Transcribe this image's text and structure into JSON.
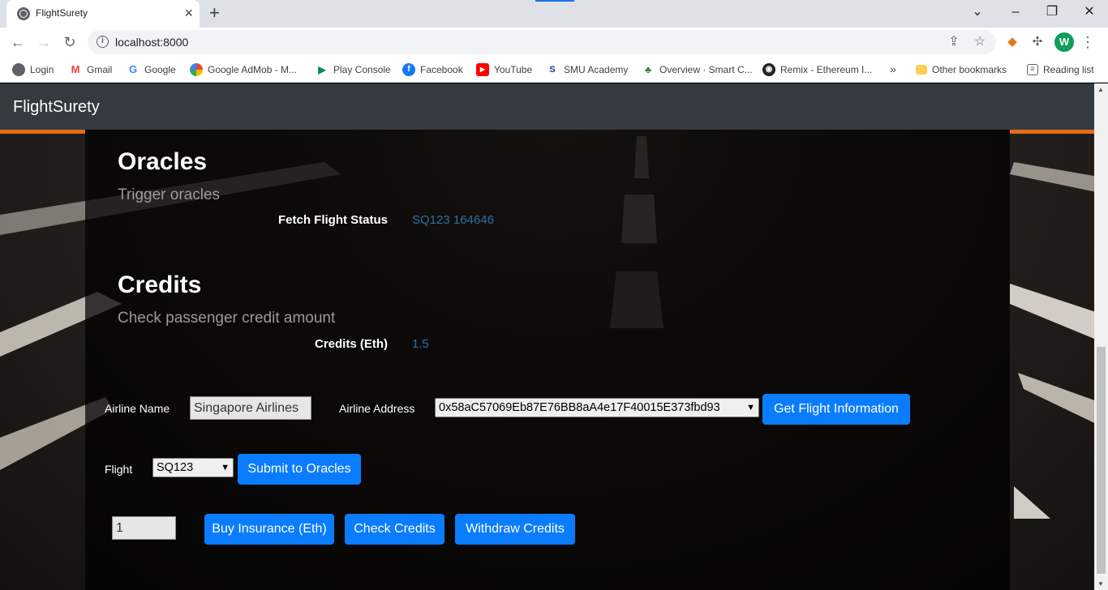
{
  "browser": {
    "tab_title": "FlightSurety",
    "url": "localhost:8000",
    "avatar_letter": "W",
    "bookmarks": [
      {
        "label": "Login",
        "icon": "globe-icon"
      },
      {
        "label": "Gmail",
        "icon": "gmail-icon"
      },
      {
        "label": "Google",
        "icon": "google-icon"
      },
      {
        "label": "Google AdMob - M...",
        "icon": "admob-icon"
      },
      {
        "label": "Play Console",
        "icon": "play-console-icon"
      },
      {
        "label": "Facebook",
        "icon": "facebook-icon"
      },
      {
        "label": "YouTube",
        "icon": "youtube-icon"
      },
      {
        "label": "SMU Academy",
        "icon": "smu-icon"
      },
      {
        "label": "Overview · Smart C...",
        "icon": "overview-icon"
      },
      {
        "label": "Remix - Ethereum I...",
        "icon": "remix-icon"
      }
    ],
    "more_bookmarks": "»",
    "other_bookmarks": "Other bookmarks",
    "reading_list": "Reading list"
  },
  "navbar": {
    "brand": "FlightSurety"
  },
  "oracles": {
    "title": "Oracles",
    "subtitle": "Trigger oracles",
    "label": "Fetch Flight Status",
    "value": "SQ123 164646"
  },
  "credits": {
    "title": "Credits",
    "subtitle": "Check passenger credit amount",
    "label": "Credits (Eth)",
    "value": "1.5"
  },
  "form": {
    "airline_name_label": "Airline Name",
    "airline_name_value": "Singapore Airlines",
    "airline_address_label": "Airline Address",
    "airline_address_value": "0x58aC57069Eb87E76BB8aA4e17F40015E373fbd93",
    "get_flight_button": "Get Flight Information",
    "flight_label": "Flight",
    "flight_value": "SQ123",
    "submit_oracles_button": "Submit to Oracles",
    "amount_value": "1",
    "buy_insurance_button": "Buy Insurance (Eth)",
    "check_credits_button": "Check Credits",
    "withdraw_credits_button": "Withdraw Credits"
  },
  "colors": {
    "accent": "#0a7cff",
    "navbar": "#343a40",
    "orange": "#e46b17",
    "value_blue": "#2f6f9f"
  }
}
